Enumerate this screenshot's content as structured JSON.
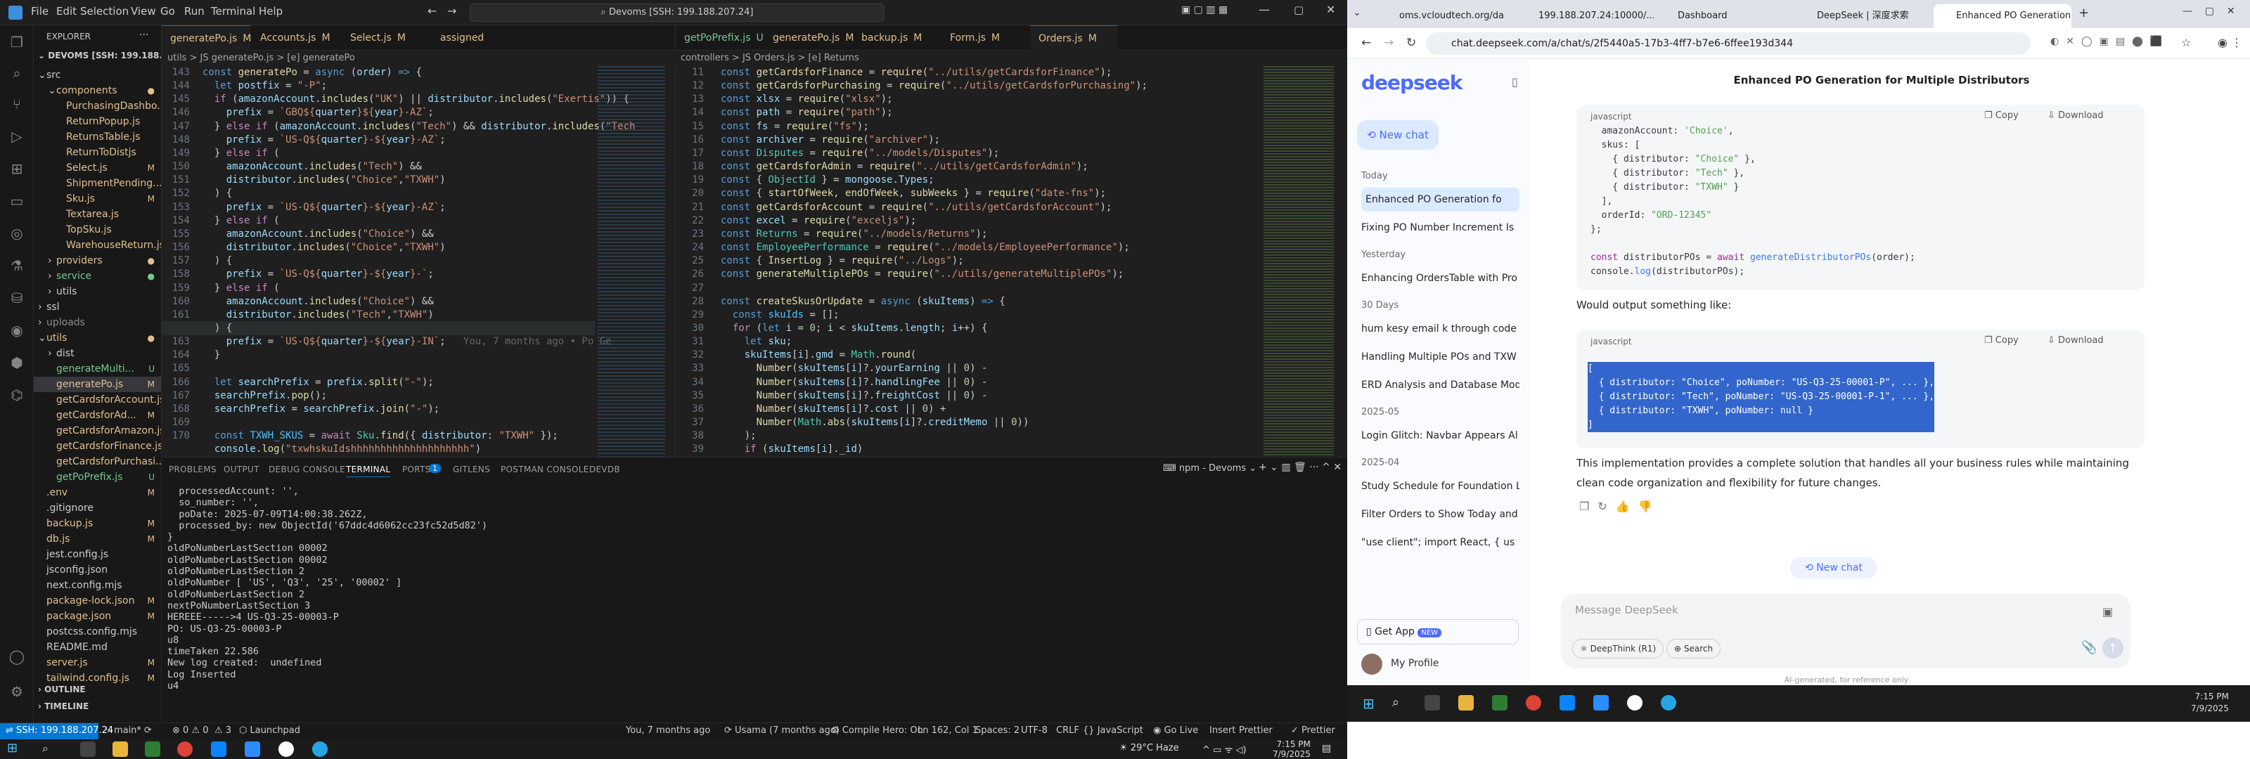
{
  "vscode": {
    "menu": [
      "File",
      "Edit",
      "Selection",
      "View",
      "Go",
      "Run",
      "Terminal",
      "Help"
    ],
    "search": "Devoms [SSH: 199.188.207.24]",
    "explorer_title": "EXPLORER",
    "root": "DEVOMS [SSH: 199.188.20...",
    "tree": [
      {
        "n": "src",
        "d": 1,
        "c": "#ccc",
        "b": "",
        "a": "v"
      },
      {
        "n": "components",
        "d": 2,
        "c": "#e2c08d",
        "b": "●",
        "a": "v"
      },
      {
        "n": "PurchasingDashbo...",
        "d": 3,
        "c": "#e2c08d",
        "b": ""
      },
      {
        "n": "ReturnPopup.js",
        "d": 3,
        "c": "#e2c08d",
        "b": ""
      },
      {
        "n": "ReturnsTable.js",
        "d": 3,
        "c": "#e2c08d",
        "b": ""
      },
      {
        "n": "ReturnToDistjs",
        "d": 3,
        "c": "#e2c08d",
        "b": ""
      },
      {
        "n": "Select.js",
        "d": 3,
        "c": "#e2c08d",
        "b": "M"
      },
      {
        "n": "ShipmentPending...",
        "d": 3,
        "c": "#e2c08d",
        "b": ""
      },
      {
        "n": "Sku.js",
        "d": 3,
        "c": "#e2c08d",
        "b": "M"
      },
      {
        "n": "Textarea.js",
        "d": 3,
        "c": "#e2c08d",
        "b": ""
      },
      {
        "n": "TopSku.js",
        "d": 3,
        "c": "#e2c08d",
        "b": ""
      },
      {
        "n": "WarehouseReturn.js",
        "d": 3,
        "c": "#e2c08d",
        "b": ""
      },
      {
        "n": "providers",
        "d": 2,
        "c": "#e2c08d",
        "b": "●",
        "a": ">"
      },
      {
        "n": "service",
        "d": 2,
        "c": "#73c991",
        "b": "●",
        "a": ">"
      },
      {
        "n": "utils",
        "d": 2,
        "c": "#ccc",
        "b": "",
        "a": ">"
      },
      {
        "n": "ssl",
        "d": 1,
        "c": "#ccc",
        "b": "",
        "a": ">"
      },
      {
        "n": "uploads",
        "d": 1,
        "c": "#8b8b8b",
        "b": "",
        "a": ">"
      },
      {
        "n": "utils",
        "d": 1,
        "c": "#e2c08d",
        "b": "●",
        "a": "v"
      },
      {
        "n": "dist",
        "d": 2,
        "c": "#ccc",
        "b": "",
        "a": ">"
      },
      {
        "n": "generateMulti...",
        "d": 2,
        "c": "#73c991",
        "b": "U"
      },
      {
        "n": "generatePo.js",
        "d": 2,
        "c": "#e2c08d",
        "b": "M",
        "sel": true
      },
      {
        "n": "getCardsforAccount.js",
        "d": 2,
        "c": "#e2c08d",
        "b": ""
      },
      {
        "n": "getCardsforAd...",
        "d": 2,
        "c": "#e2c08d",
        "b": "M"
      },
      {
        "n": "getCardsforAmazon.js",
        "d": 2,
        "c": "#e2c08d",
        "b": ""
      },
      {
        "n": "getCardsforFinance.js",
        "d": 2,
        "c": "#e2c08d",
        "b": ""
      },
      {
        "n": "getCardsforPurchasi...",
        "d": 2,
        "c": "#e2c08d",
        "b": ""
      },
      {
        "n": "getPoPrefix.js",
        "d": 2,
        "c": "#73c991",
        "b": "U"
      },
      {
        "n": ".env",
        "d": 1,
        "c": "#e2c08d",
        "b": "M"
      },
      {
        "n": ".gitignore",
        "d": 1,
        "c": "#ccc",
        "b": ""
      },
      {
        "n": "backup.js",
        "d": 1,
        "c": "#e2c08d",
        "b": "M"
      },
      {
        "n": "db.js",
        "d": 1,
        "c": "#e2c08d",
        "b": "M"
      },
      {
        "n": "jest.config.js",
        "d": 1,
        "c": "#ccc",
        "b": ""
      },
      {
        "n": "jsconfig.json",
        "d": 1,
        "c": "#ccc",
        "b": ""
      },
      {
        "n": "next.config.mjs",
        "d": 1,
        "c": "#ccc",
        "b": ""
      },
      {
        "n": "package-lock.json",
        "d": 1,
        "c": "#e2c08d",
        "b": "M"
      },
      {
        "n": "package.json",
        "d": 1,
        "c": "#e2c08d",
        "b": "M"
      },
      {
        "n": "postcss.config.mjs",
        "d": 1,
        "c": "#ccc",
        "b": ""
      },
      {
        "n": "README.md",
        "d": 1,
        "c": "#ccc",
        "b": ""
      },
      {
        "n": "server.js",
        "d": 1,
        "c": "#e2c08d",
        "b": "M"
      },
      {
        "n": "tailwind.config.js",
        "d": 1,
        "c": "#e2c08d",
        "b": "M"
      }
    ],
    "outline": "OUTLINE",
    "timeline": "TIMELINE",
    "tabs_left": [
      {
        "l": "generatePo.js",
        "b": "M",
        "a": true
      },
      {
        "l": "Accounts.js",
        "b": "M"
      },
      {
        "l": "Select.js",
        "b": "M"
      },
      {
        "l": "assigned",
        "b": ""
      }
    ],
    "tabs_right": [
      {
        "l": "getPoPrefix.js",
        "b": "U"
      },
      {
        "l": "generatePo.js",
        "b": "M"
      },
      {
        "l": "backup.js",
        "b": "M"
      },
      {
        "l": "Form.js",
        "b": "M"
      },
      {
        "l": "Orders.js",
        "b": "M",
        "a": true
      }
    ],
    "bc_left": "utils > JS generatePo.js > [e] generatePo",
    "bc_right": "controllers > JS Orders.js > [e] Returns",
    "code_left_lines": "143\n144\n145\n146\n147\n148\n149\n150\n151\n152\n153\n154\n155\n156\n157\n158\n159\n160\n161\n162\n163\n164\n165\n166\n167\n168\n169\n170",
    "code_right_lines": "11\n12\n13\n14\n15\n16\n17\n18\n19\n20\n21\n22\n23\n24\n25\n26\n27\n28\n29\n30\n31\n32\n33\n34\n35\n36\n37\n38\n39",
    "blame": "You, 7 months ago • Po Ge",
    "panel_tabs": [
      "PROBLEMS",
      "OUTPUT",
      "DEBUG CONSOLE",
      "TERMINAL",
      "PORTS",
      "GITLENS",
      "POSTMAN CONSOLE",
      "DEVDB"
    ],
    "ports_badge": "1",
    "terminal_label": "npm - Devoms",
    "terminal": "  processedAccount: '',\n  so_number: '',\n  poDate: 2025-07-09T14:00:38.262Z,\n  processed_by: new ObjectId('67ddc4d6062cc23fc52d5d82')\n}\noldPoNumberLastSection 00002\noldPoNumberLastSection 00002\noldPoNumberLastSection 2\noldPoNumber [ 'US', 'Q3', '25', '00002' ]\noldPoNumberLastSection 2\nnextPoNumberLastSection 3\nHEREEE----->4 US-Q3-25-00003-P\nPO: US-Q3-25-00003-P\nu8\ntimeTaken 22.586\nNew log created:  undefined\nLog Inserted\nu4",
    "status": {
      "remote": "SSH: 199.188.207.24",
      "branch": "main*",
      "sync": "",
      "errors": "⊗ 0 ⚠ 0",
      "w3": "3",
      "launch": "Launchpad",
      "blame": "You, 7 months ago",
      "author": "Usama (7 months ago)",
      "compile": "Compile Hero: On",
      "pos": "Ln 162, Col 1",
      "spaces": "Spaces: 2",
      "enc": "UTF-8",
      "eol": "CRLF",
      "lang": "JavaScript",
      "golive": "Go Live",
      "insert": "Insert",
      "prettier": "Prettier",
      "prettier2": "Prettier"
    },
    "taskbar": {
      "weather": "29°C Haze",
      "time": "7:15 PM",
      "date": "7/9/2025"
    }
  },
  "chrome": {
    "tabs": [
      "oms.vcloudtech.org/da",
      "199.188.207.24:10000/...",
      "Dashboard",
      "DeepSeek | 深度求索",
      "Enhanced PO Generation..."
    ],
    "url": "chat.deepseek.com/a/chat/s/2f5440a5-17b3-4ff7-b7e6-6ffee193d344",
    "logo": "deepseek",
    "new_chat": "New chat",
    "history": [
      {
        "h": "Today"
      },
      {
        "i": "Enhanced PO Generation fo",
        "active": true
      },
      {
        "i": "Fixing PO Number Increment Is"
      },
      {
        "h": "Yesterday"
      },
      {
        "i": "Enhancing OrdersTable with Pro"
      },
      {
        "h": "30 Days"
      },
      {
        "i": "hum kesy email k through code"
      },
      {
        "i": "Handling Multiple POs and TXW"
      },
      {
        "i": "ERD Analysis and Database Mod"
      },
      {
        "h": "2025-05"
      },
      {
        "i": "Login Glitch: Navbar Appears Al"
      },
      {
        "h": "2025-04"
      },
      {
        "i": "Study Schedule for Foundation L"
      },
      {
        "i": "Filter Orders to Show Today and"
      },
      {
        "i": "\"use client\"; import React, { us"
      }
    ],
    "get_app": "Get App",
    "new_badge": "NEW",
    "profile": "My Profile",
    "chat_title": "Enhanced PO Generation for Multiple Distributors",
    "code_lang": "javascript",
    "copy": "Copy",
    "download": "Download",
    "para1": "Would output something like:",
    "para2": "This implementation provides a complete solution that handles all your business rules while maintaining clean code organization and flexibility for future changes.",
    "new_chat_btn": "New chat",
    "placeholder": "Message DeepSeek",
    "deepthink": "DeepThink (R1)",
    "search": "Search",
    "footer": "AI-generated, for reference only",
    "taskbar": {
      "time": "7:15 PM",
      "date": "7/9/2025"
    }
  }
}
